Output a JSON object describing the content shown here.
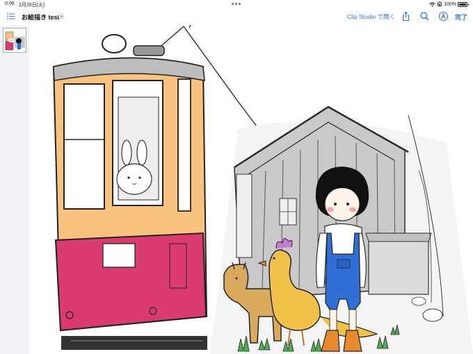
{
  "status_bar": {
    "time": "0:06",
    "date": "2月28日(火)",
    "battery": "100%",
    "icons": [
      "wifi-icon",
      "orientation-lock-icon",
      "battery-icon"
    ]
  },
  "toolbar": {
    "document_title": "お絵描き test",
    "open_in_label": "Clip Studio で開く",
    "done_label": "完了",
    "icons": [
      "list-icon",
      "chevron-down-icon",
      "share-icon",
      "search-icon",
      "markup-icon"
    ],
    "accent_color": "#2f6fde"
  },
  "sidebar": {
    "pages": [
      {
        "selected": true
      }
    ]
  },
  "canvas": {
    "colors": {
      "tram_upper": "#f8c27f",
      "tram_lower": "#d93b6e",
      "shed_gray": "#c9c9c9",
      "overalls_blue": "#2f6fd6",
      "chicken_yellow": "#f2c14a",
      "giraffe_tan": "#d9a95c"
    }
  }
}
